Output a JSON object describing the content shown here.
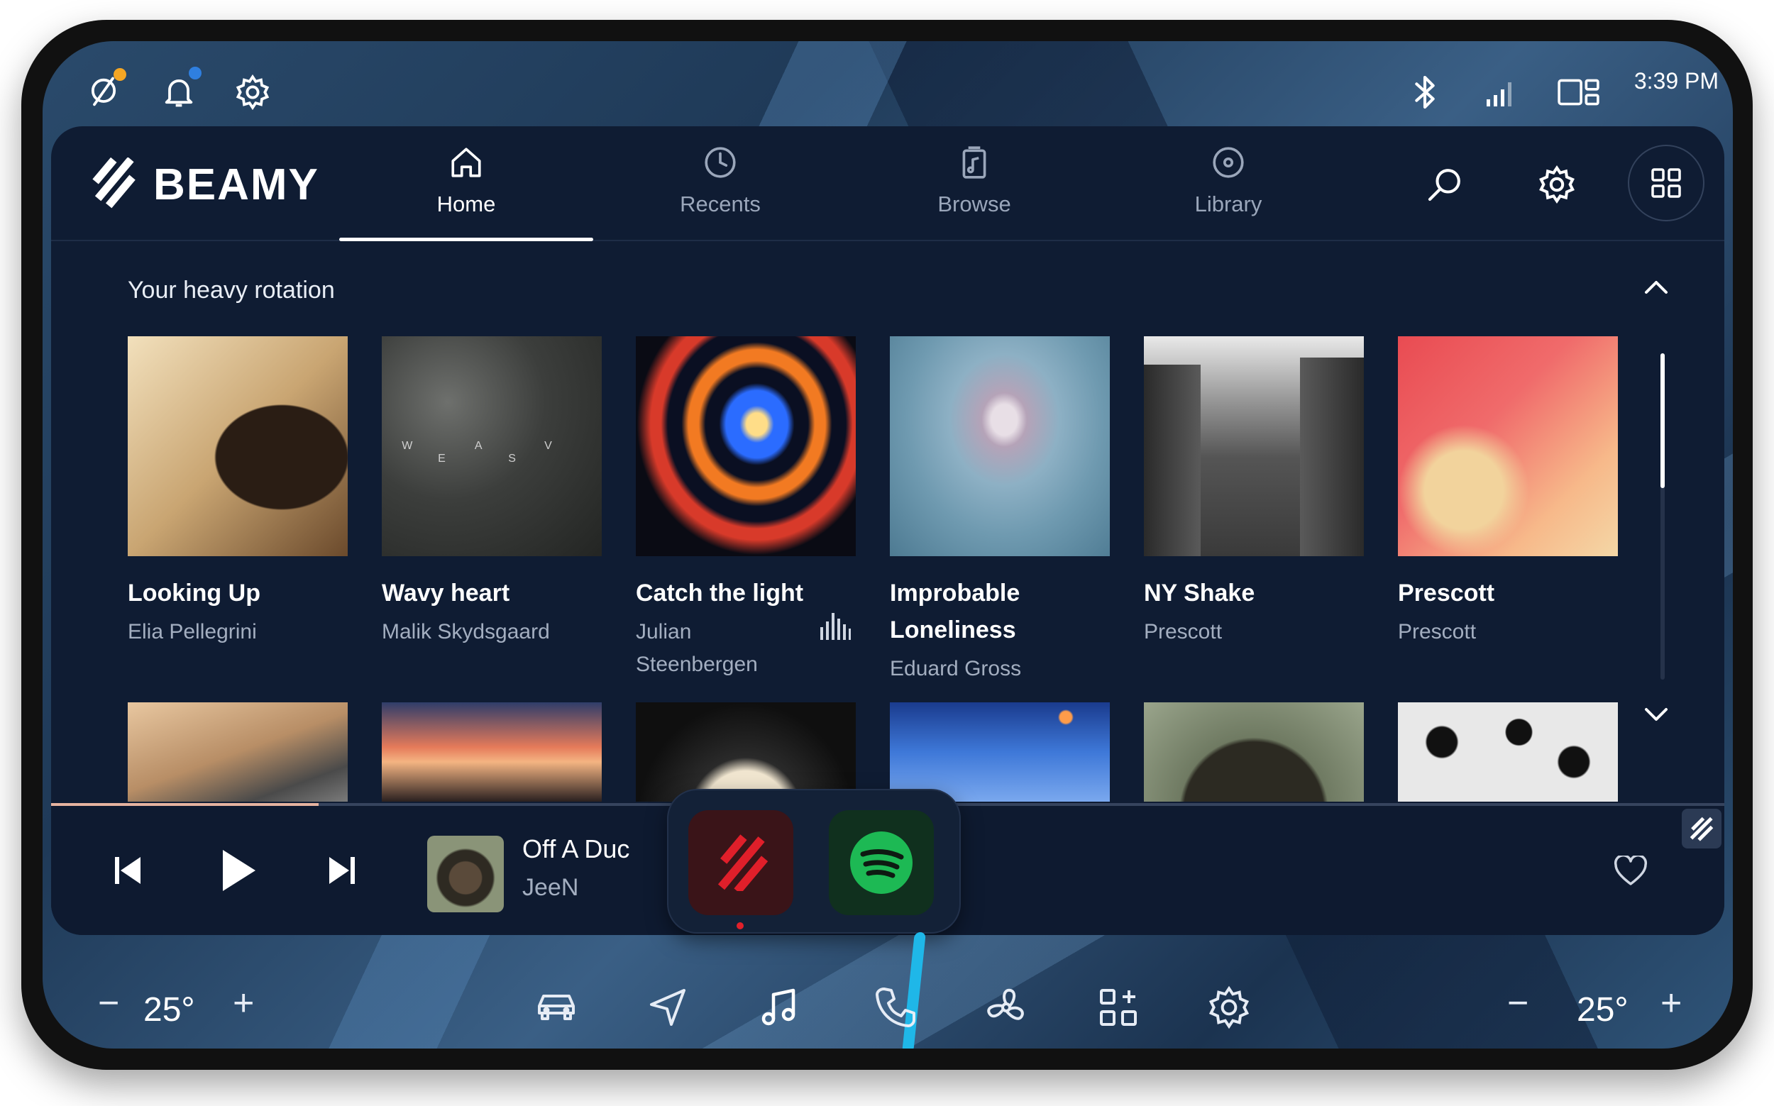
{
  "status_bar": {
    "time": "3:39 PM",
    "left_icons": [
      "voice-assistant-icon",
      "notification-bell-icon",
      "settings-gear-icon"
    ],
    "right_icons": [
      "bluetooth-icon",
      "signal-strength-icon",
      "display-mode-icon"
    ],
    "indicator_colors": {
      "voice": "#f5a623",
      "notification": "#2f7fe0"
    }
  },
  "header": {
    "brand": "BEAMY",
    "tabs": [
      {
        "label": "Home",
        "icon": "home-icon",
        "active": true
      },
      {
        "label": "Recents",
        "icon": "clock-icon",
        "active": false
      },
      {
        "label": "Browse",
        "icon": "music-file-icon",
        "active": false
      },
      {
        "label": "Library",
        "icon": "disc-icon",
        "active": false
      }
    ],
    "actions": [
      "search-icon",
      "gear-icon",
      "grid-icon"
    ]
  },
  "section": {
    "title": "Your heavy rotation",
    "albums": [
      {
        "title": "Looking Up",
        "artist": "Elia Pellegrini"
      },
      {
        "title": "Wavy heart",
        "artist": "Malik Skydsgaard",
        "cover_text": "W A V E S"
      },
      {
        "title": "Catch the light",
        "artist_line1": "Julian",
        "artist_line2": "Steenbergen",
        "playing": true
      },
      {
        "title_line1": "Improbable",
        "title_line2": "Loneliness",
        "artist": "Eduard Gross"
      },
      {
        "title": "NY Shake",
        "artist": "Prescott"
      },
      {
        "title": "Prescott",
        "artist": "Prescott"
      }
    ]
  },
  "player": {
    "track_title": "Off A Duc",
    "artist": "JeeN",
    "progress_fraction": 0.16,
    "liked": false
  },
  "app_switcher": {
    "apps": [
      "beamy-app-icon",
      "spotify-app-icon"
    ],
    "active_indicator_color": "#e0202a",
    "colors": {
      "beamy": "#e01f2a",
      "spotify": "#1db954"
    }
  },
  "climate": {
    "left_temp": "25°",
    "right_temp": "25°"
  },
  "dock": [
    "car-icon",
    "navigation-icon",
    "music-note-icon",
    "phone-icon",
    "fan-icon",
    "apps-add-icon",
    "settings-icon"
  ],
  "accent_color": "#1fb7e8"
}
